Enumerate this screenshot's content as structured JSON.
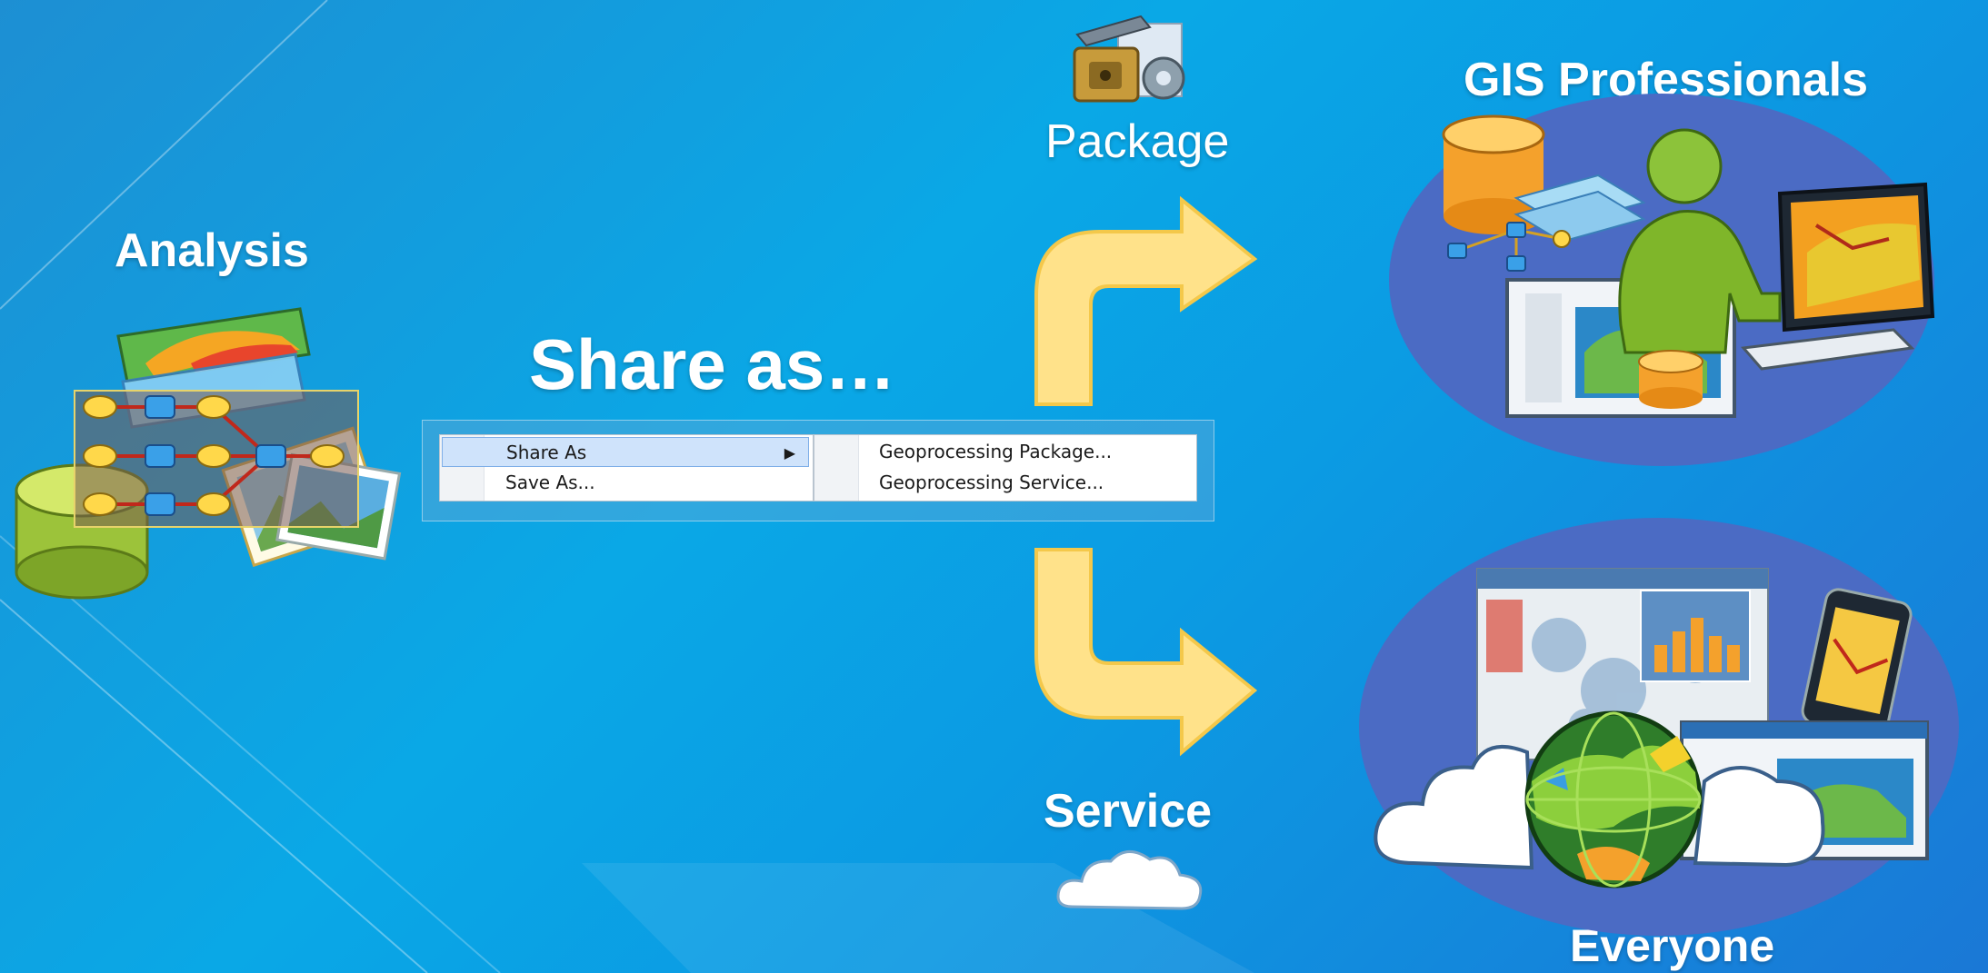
{
  "labels": {
    "analysis": "Analysis",
    "share_as": "Share as…",
    "package": "Package",
    "service": "Service",
    "gis_professionals": "GIS Professionals",
    "everyone": "Everyone"
  },
  "menu": {
    "items": [
      {
        "label": "Share As",
        "highlighted": true,
        "has_submenu": true
      },
      {
        "label": "Save As..."
      }
    ],
    "submenu": [
      {
        "label": "Geoprocessing Package..."
      },
      {
        "label": "Geoprocessing Service..."
      }
    ]
  },
  "icons": [
    "analysis-model-icon",
    "package-icon",
    "cloud-icon",
    "gis-professional-icon",
    "everyone-web-icon",
    "arrow-up-right-icon",
    "arrow-down-right-icon"
  ],
  "colors": {
    "background": "#0aa8e6",
    "arrow": "#ffe28a",
    "ellipse": "#4b6bc4",
    "menu_highlight": "#cfe3fb"
  }
}
